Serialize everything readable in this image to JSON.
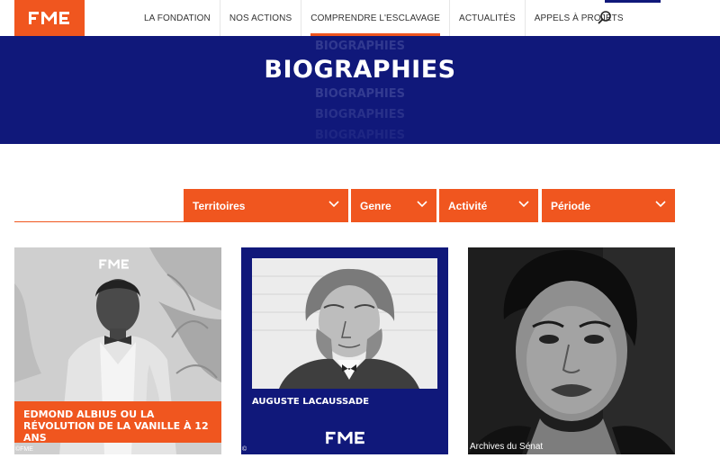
{
  "header": {
    "logo_text": "FME",
    "nav": [
      {
        "label": "LA FONDATION"
      },
      {
        "label": "NOS ACTIONS"
      },
      {
        "label": "COMPRENDRE L'ESCLAVAGE"
      },
      {
        "label": "ACTUALITÉS"
      },
      {
        "label": "APPELS À PROJETS"
      }
    ],
    "active_index": 2,
    "search_icon": "search-icon"
  },
  "hero": {
    "title": "BIOGRAPHIES",
    "ghost_text": "BIOGRAPHIES"
  },
  "filters": [
    {
      "label": "Territoires"
    },
    {
      "label": "Genre"
    },
    {
      "label": "Activité"
    },
    {
      "label": "Période"
    }
  ],
  "cards": [
    {
      "title": "EDMOND ALBIUS OU LA RÉVOLUTION DE LA VANILLE À 12 ANS",
      "credit": "©FME"
    },
    {
      "title": "AUGUSTE LACAUSSADE",
      "credit": "©"
    },
    {
      "title": "",
      "credit": "Archives du Sénat"
    }
  ],
  "colors": {
    "orange": "#f0561f",
    "navy": "#10187a"
  }
}
